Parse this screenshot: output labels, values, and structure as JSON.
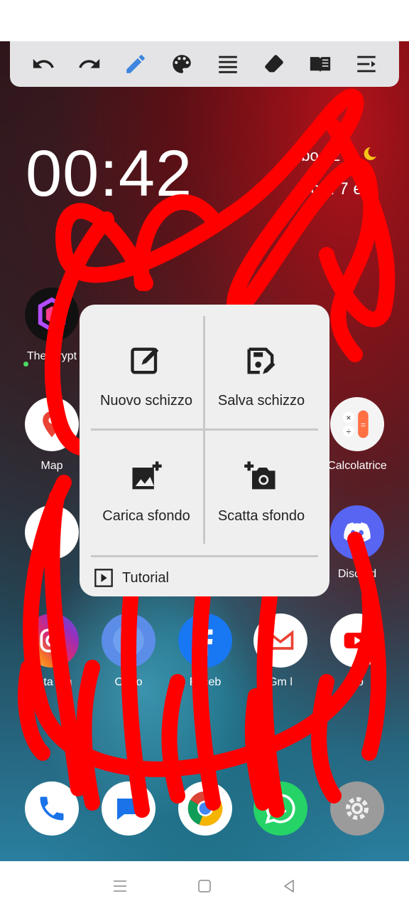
{
  "toolbar": {
    "tools": [
      "undo-icon",
      "redo-icon",
      "pen-icon",
      "palette-icon",
      "line-width-icon",
      "eraser-icon",
      "book-icon",
      "menu-icon"
    ],
    "active_color": "#3d85e0",
    "icon_color": "#222222"
  },
  "lockscreen": {
    "time": "00:42",
    "date": "ebo 22",
    "weekday": "dom 7 et"
  },
  "apps": {
    "crypto": "The Crypt",
    "maps": "Map",
    "calc": "Calcolatrice",
    "pay": "ay",
    "discord": "Discord",
    "instagram": "nsta  am",
    "clock": "Orolo",
    "facebook": "Faceb",
    "gmail": "Gm l",
    "youtube": "   ub"
  },
  "popup": {
    "new_sketch": "Nuovo schizzo",
    "save_sketch": "Salva schizzo",
    "load_bg": "Carica sfondo",
    "take_bg": "Scatta sfondo",
    "tutorial": "Tutorial"
  },
  "colors": {
    "scribble": "#ff0000",
    "popup_bg": "#efefef",
    "toolbar_bg": "#e4e4e6"
  }
}
